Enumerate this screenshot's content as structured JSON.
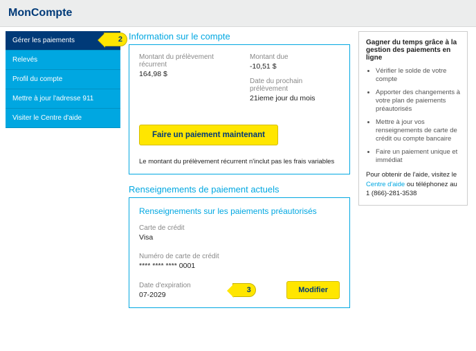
{
  "header": {
    "title": "MonCompte"
  },
  "sidebar": {
    "items": [
      {
        "label": "Gérer les paiements"
      },
      {
        "label": "Relevés"
      },
      {
        "label": "Profil du compte"
      },
      {
        "label": "Mettre à jour l'adresse 911"
      },
      {
        "label": "Visiter le Centre d'aide"
      }
    ]
  },
  "account_info": {
    "section_title": "Information sur le compte",
    "recurring_label": "Montant du prélèvement récurrent",
    "recurring_value": "164,98 $",
    "due_label": "Montant due",
    "due_value": "-10,51 $",
    "next_withdraw_label": "Date du prochain prélèvement",
    "next_withdraw_value": "21ieme jour du mois",
    "pay_now_label": "Faire un paiement maintenant",
    "note": "Le montant du prélèvement récurrent n'inclut pas les frais variables"
  },
  "payment_details": {
    "section_title": "Renseignements de paiement actuels",
    "preauth_title": "Renseignements sur les paiements préautorisés",
    "card_type_label": "Carte de crédit",
    "card_type_value": "Visa",
    "card_num_label": "Numéro de carte de crédit",
    "card_num_value": "**** **** **** 0001",
    "exp_label": "Date d'expiration",
    "exp_value": "07-2029",
    "modify_label": "Modifier"
  },
  "help_panel": {
    "title": "Gagner du temps grâce à la gestion des paiements en ligne",
    "bullets": [
      "Vérifier le solde de votre compte",
      "Apporter des changements à votre plan de paiements préautorisés",
      "Mettre à jour vos renseignements de carte de crédit ou compte bancaire",
      "Faire un paiement unique et immédiat"
    ],
    "help_prefix": "Pour obtenir de l'aide, visitez le ",
    "help_link": "Centre d'aide",
    "help_suffix": " ou téléphonez au ",
    "phone": "1 (866)-281-3538"
  },
  "annotations": {
    "num2": "2",
    "num3": "3"
  }
}
